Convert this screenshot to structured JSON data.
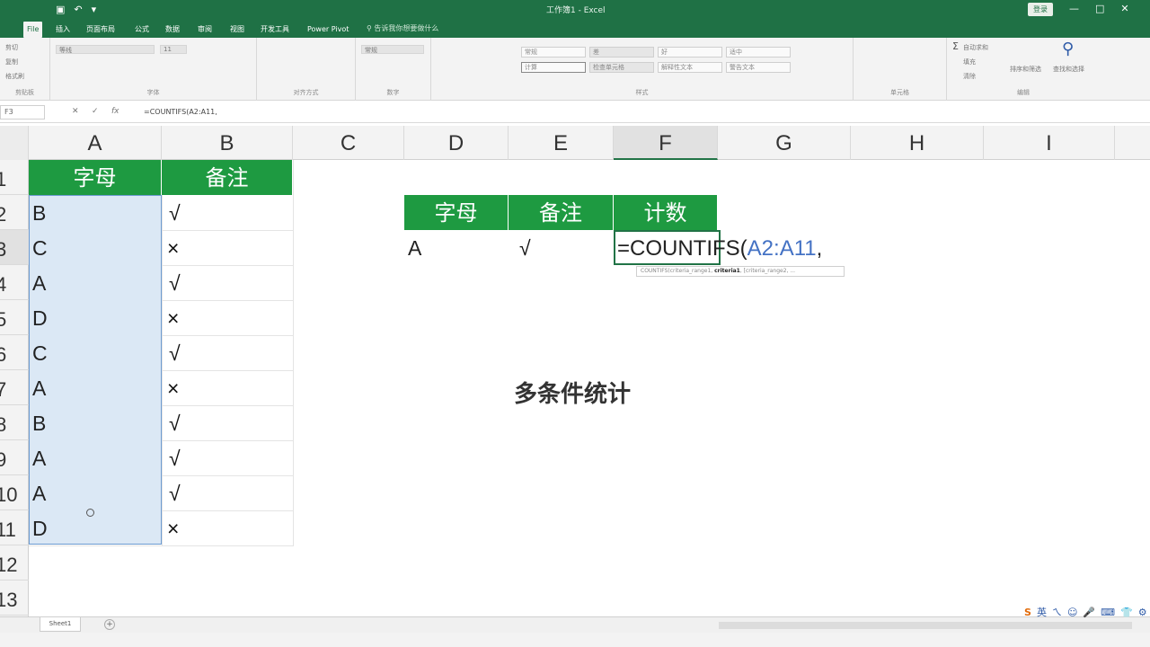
{
  "window": {
    "title": "工作簿1 - Excel",
    "login_label": "登录",
    "win_controls": [
      "—",
      "□",
      "✕"
    ]
  },
  "tabs": [
    "File",
    "插入",
    "页面布局",
    "公式",
    "数据",
    "审阅",
    "视图",
    "开发工具",
    "Power Pivot"
  ],
  "tell_me": "告诉我你想要做什么",
  "ribbon": {
    "groups": [
      "剪贴板",
      "字体",
      "对齐方式",
      "数字",
      "样式",
      "单元格",
      "编辑"
    ],
    "clipboard": [
      "剪切",
      "复制",
      "格式刷"
    ],
    "font_name": "等线",
    "font_size": "11",
    "number_format": "常规",
    "styles": [
      "常规",
      "差",
      "好",
      "适中",
      "计算",
      "检查单元格",
      "解释性文本",
      "警告文本"
    ],
    "editing": [
      "自动求和",
      "填充",
      "清除",
      "排序和筛选",
      "查找和选择"
    ]
  },
  "formula_bar": {
    "name_box": "F3",
    "formula": "=COUNTIFS(A2:A11,"
  },
  "columns": [
    "A",
    "B",
    "C",
    "D",
    "E",
    "F",
    "G",
    "H",
    "I"
  ],
  "rows": [
    "1",
    "2",
    "3",
    "4",
    "5",
    "6",
    "7",
    "8",
    "9",
    "10",
    "11",
    "12",
    "13"
  ],
  "table1": {
    "headers": [
      "字母",
      "备注"
    ],
    "letters": [
      "B",
      "C",
      "A",
      "D",
      "C",
      "A",
      "B",
      "A",
      "A",
      "D"
    ],
    "marks": [
      "√",
      "×",
      "√",
      "×",
      "√",
      "×",
      "√",
      "√",
      "√",
      "×"
    ]
  },
  "table2": {
    "headers": [
      "字母",
      "备注",
      "计数"
    ],
    "letter": "A",
    "mark": "√",
    "formula_eq": "=COUNTIFS(",
    "formula_range": "A2:A11",
    "formula_tail": ","
  },
  "tooltip": {
    "pre": "COUNTIFS(criteria_range1, ",
    "bold": "criteria1",
    "post": ", [criteria_range2, ..."
  },
  "caption": "多条件统计",
  "sheet_tab": "Sheet1",
  "add_sheet": "+",
  "tray": {
    "logo": "S",
    "items": [
      "英",
      "ㄟ",
      "☺",
      "🎤",
      "⌨",
      "👕",
      "⚙"
    ]
  }
}
